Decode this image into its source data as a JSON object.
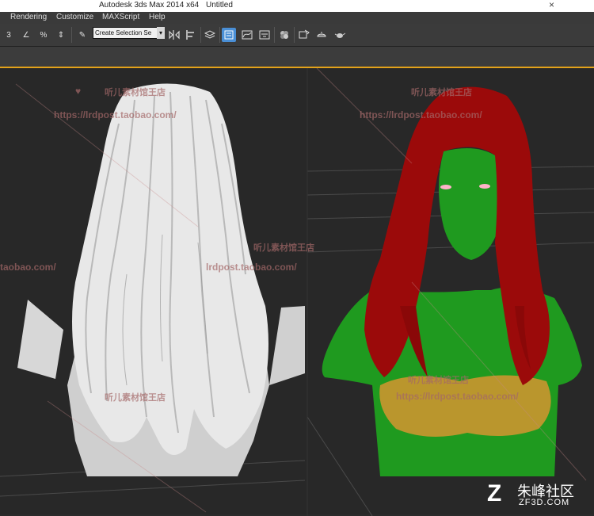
{
  "window": {
    "app_title": "Autodesk 3ds Max  2014 x64",
    "document": "Untitled",
    "close_glyph": "×"
  },
  "menu": [
    "Rendering",
    "Customize",
    "MAXScript",
    "Help"
  ],
  "toolbar": {
    "snap_3": "3",
    "angle_snap": "∠",
    "percent_snap": "%",
    "spinner_snap": "⇕",
    "edit_named_sets": "✎",
    "selection_set_placeholder": "Create Selection Se",
    "icons": [
      "mirror-icon",
      "align-icon",
      "layer-manager-icon",
      "scene-explorer-icon",
      "curve-editor-icon",
      "schematic-view-icon",
      "material-editor-icon",
      "render-setup-icon",
      "rendered-frame-icon",
      "render-teapot-icon"
    ]
  },
  "watermarks": {
    "shop_name": "听儿素材馆王店",
    "shop_url": "https://lrdpost.taobao.com/",
    "shop_url_partial": "lrdpost.taobao.com/",
    "shop_url_left": "taobao.com/"
  },
  "brand": {
    "icon": "Z",
    "name": "朱峰社区",
    "url": "ZF3D.COM"
  },
  "colors": {
    "viewport_border": "#e3a21a",
    "hair_left": "#e6e6e6",
    "hair_right": "#9b0a0a",
    "body_right": "#1f9a1f",
    "bra": "#c8962f",
    "active_button": "#4a8fd6"
  }
}
